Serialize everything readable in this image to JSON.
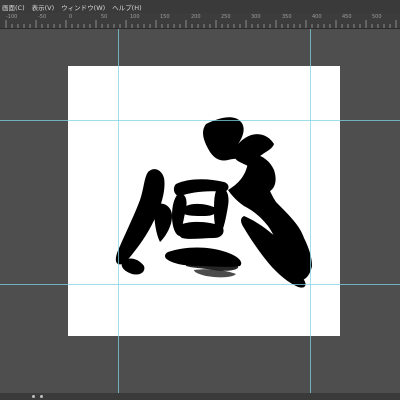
{
  "menu": {
    "items": [
      "画面(C)",
      "表示(V)",
      "ウィンドウ(W)",
      "ヘルプ(H)"
    ]
  },
  "ruler": {
    "ticks": [
      "-100",
      "-50",
      "0",
      "50",
      "100",
      "150",
      "200",
      "250",
      "300",
      "350",
      "400",
      "450",
      "500"
    ]
  },
  "canvas": {
    "artwork": "calligraphy-kanji"
  },
  "colors": {
    "workspace": "#4e4e4e",
    "guide": "#7fd4e6",
    "canvas": "#ffffff",
    "ink": "#000000"
  }
}
